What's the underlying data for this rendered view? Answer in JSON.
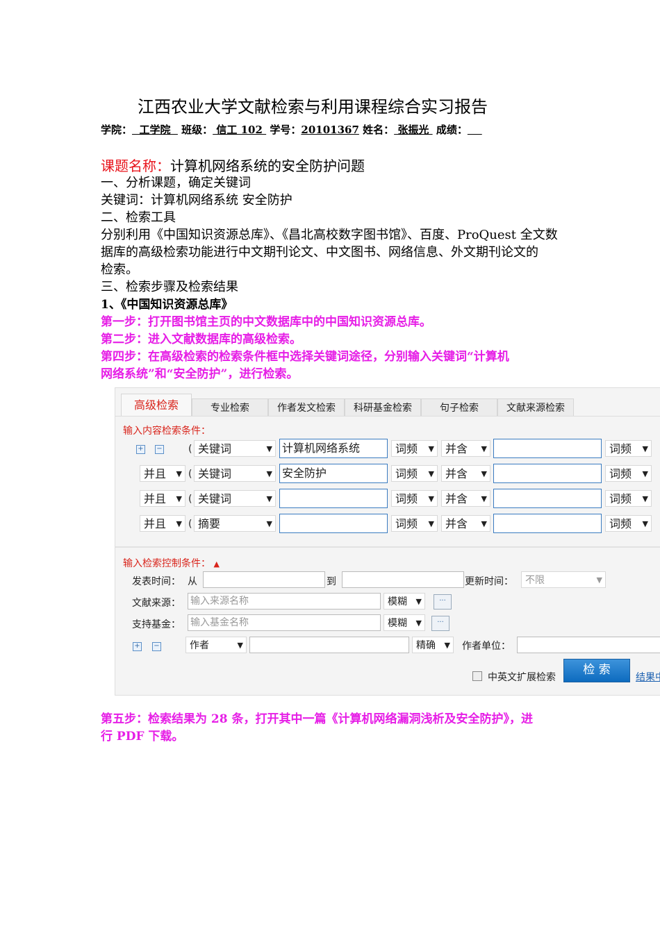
{
  "doc": {
    "title": "江西农业大学文献检索与利用课程综合实习报告",
    "info": {
      "college_label": "学院：",
      "college": "  工学院  ",
      "class_label": "班级：",
      "class": " 信工 102 ",
      "id_label": "学号：",
      "id": "20101367",
      "name_label": "姓名：",
      "name": " 张振光 ",
      "score_label": "成绩：",
      "score": "    "
    },
    "topic_label": "课题名称：",
    "topic": "计算机网络系统的安全防护问题",
    "lines": [
      "一、分析课题，确定关键词",
      "关键词：计算机网络系统  安全防护",
      "二、检索工具",
      "分别利用《中国知识资源总库》、《昌北高校数字图书馆》、百度、ProQuest 全文数",
      "据库的高级检索功能进行中文期刊论文、中文图书、网络信息、外文期刊论文的",
      "检索。",
      "三、检索步骤及检索结果",
      "1、《中国知识资源总库》"
    ],
    "steps": [
      "第一步：打开图书馆主页的中文数据库中的中国知识资源总库。",
      "第二步：进入文献数据库的高级检索。",
      "第四步：在高级检索的检索条件框中选择关键词途径，分别输入关键词“计算机",
      "网络系统”和“安全防护”，进行检索。"
    ],
    "step5": [
      "第五步：检索结果为 28 条，打开其中一篇《计算机网络漏洞浅析及安全防护》，进",
      "行 PDF 下载。"
    ]
  },
  "ui": {
    "tabs": [
      "高级检索",
      "专业检索",
      "作者发文检索",
      "科研基金检索",
      "句子检索",
      "文献来源检索"
    ],
    "content_label": "输入内容检索条件：",
    "rows": [
      {
        "logic": "",
        "field": "关键词",
        "term": "计算机网络系统",
        "freq": "词频",
        "rel": "并含",
        "term2": "",
        "freq2": "词频"
      },
      {
        "logic": "并且",
        "field": "关键词",
        "term": "安全防护",
        "freq": "词频",
        "rel": "并含",
        "term2": "",
        "freq2": "词频"
      },
      {
        "logic": "并且",
        "field": "关键词",
        "term": "",
        "freq": "词频",
        "rel": "并含",
        "term2": "",
        "freq2": "词频"
      },
      {
        "logic": "并且",
        "field": "摘要",
        "term": "",
        "freq": "词频",
        "rel": "并含",
        "term2": "",
        "freq2": "词频"
      }
    ],
    "paren": "(",
    "plus": "+",
    "minus": "−",
    "control_label": "输入检索控制条件：",
    "pub_time_label": "发表时间：",
    "from": "从",
    "to": "到",
    "update_label": "更新时间：",
    "update_value": "不限",
    "source_label": "文献来源：",
    "source_placeholder": "输入来源名称",
    "source_match": "模糊",
    "fund_label": "支持基金：",
    "fund_placeholder": "输入基金名称",
    "fund_match": "模糊",
    "dots": "···",
    "author_field": "作者",
    "author_match": "精确",
    "affil_label": "作者单位：",
    "expand_label": "中英文扩展检索",
    "search_button": "检 索",
    "result_link": "结果中"
  }
}
